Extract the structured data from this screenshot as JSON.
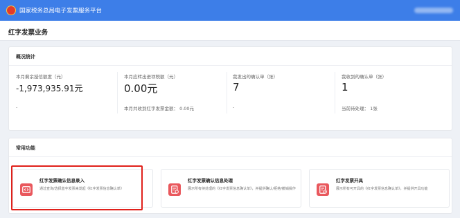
{
  "header": {
    "app_title": "国家税务总局电子发票服务平台"
  },
  "page": {
    "title": "红字发票业务"
  },
  "overview": {
    "title": "概况统计",
    "stats": [
      {
        "label": "本月剩余授信额度（元）",
        "value": "-1,973,935.91元",
        "foot": "-"
      },
      {
        "label": "本月应转出进项税额（元）",
        "value": "0.00元",
        "foot": "本月共收到红字发票金额： 0.00元"
      },
      {
        "label": "我发出的确认单（张）",
        "value": "7",
        "foot": "-"
      },
      {
        "label": "我收到的确认单（张）",
        "value": "1",
        "foot": "当前待处理： 1张"
      }
    ]
  },
  "functions": {
    "title": "常用功能",
    "items": [
      {
        "title": "红字发票确认信息录入",
        "desc": "通过查询/选择蓝字发票来发起《红字发票信息确认单》",
        "icon": "form-entry-icon"
      },
      {
        "title": "红字发票确认信息处理",
        "desc": "展示所有待处理的《红字发票信息确认单》，并提供确认/拒绝/撤销操作",
        "icon": "document-process-icon"
      },
      {
        "title": "红字发票开具",
        "desc": "展示所有可开具的《红字发票信息确认单》，并提供开具功能",
        "icon": "invoice-issue-icon"
      }
    ]
  },
  "colors": {
    "topbar": "#3d7ee8",
    "icon_accent": "#e9585d",
    "highlight_border": "#e0201a"
  }
}
